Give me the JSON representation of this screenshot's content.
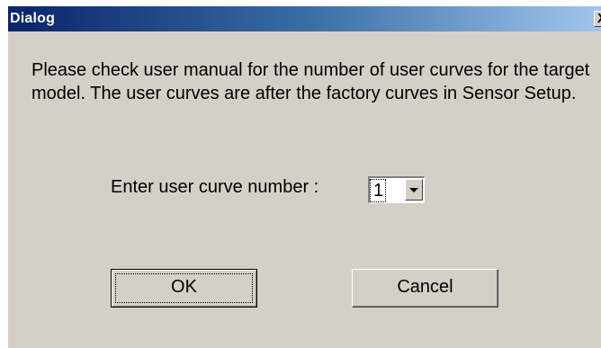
{
  "window": {
    "title": "Dialog",
    "close_glyph": "X"
  },
  "message": {
    "text": "Please check user manual for the number of user curves for the target model. The user curves are after the factory curves in Sensor Setup."
  },
  "curve_number": {
    "label": "Enter user curve number :",
    "selected_value": "1"
  },
  "buttons": {
    "ok_label": "OK",
    "cancel_label": "Cancel"
  },
  "colors": {
    "titlebar_start": "#0a246a",
    "titlebar_end": "#a6caf0",
    "dialog_background": "#d4d0c8"
  }
}
